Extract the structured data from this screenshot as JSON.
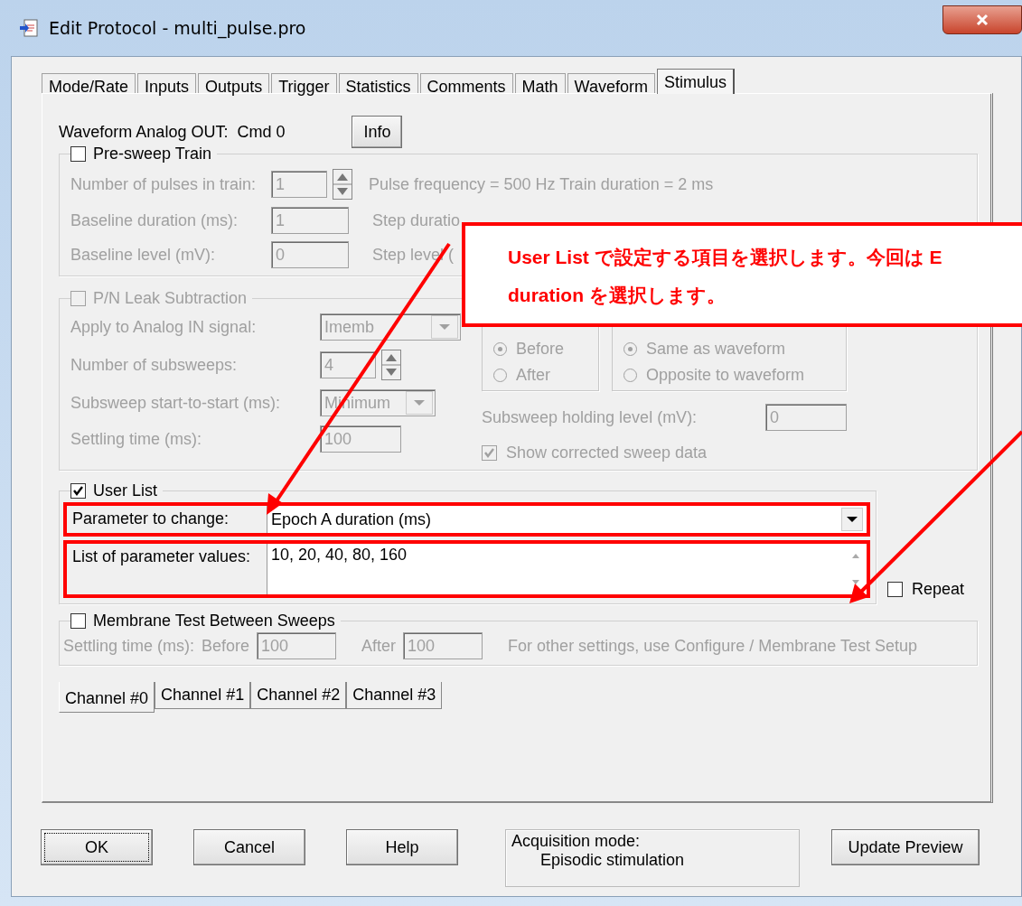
{
  "window": {
    "title": "Edit Protocol - multi_pulse.pro"
  },
  "tabs": [
    {
      "label": "Mode/Rate",
      "selected": false
    },
    {
      "label": "Inputs",
      "selected": false
    },
    {
      "label": "Outputs",
      "selected": false
    },
    {
      "label": "Trigger",
      "selected": false
    },
    {
      "label": "Statistics",
      "selected": false
    },
    {
      "label": "Comments",
      "selected": false
    },
    {
      "label": "Math",
      "selected": false
    },
    {
      "label": "Waveform",
      "selected": false
    },
    {
      "label": "Stimulus",
      "selected": true
    }
  ],
  "waveform_output": {
    "label": "Waveform Analog OUT:",
    "value": "Cmd 0",
    "button": "Info"
  },
  "presweep_train": {
    "label": "Pre-sweep Train",
    "checked": false,
    "pulses_label": "Number of pulses in train:",
    "pulses_value": "1",
    "summary": "Pulse frequency = 500 Hz  Train duration = 2 ms",
    "baseline_duration_label": "Baseline duration (ms):",
    "baseline_duration_value": "1",
    "step_duration_label": "Step duratio",
    "baseline_level_label": "Baseline level (mV):",
    "baseline_level_value": "0",
    "step_level_label": "Step level ("
  },
  "pn_leak": {
    "label": "P/N Leak Subtraction",
    "checked": false,
    "disabled": true,
    "apply_label": "Apply to Analog IN signal:",
    "apply_value": "Imemb",
    "subsweeps_label": "Number of subsweeps:",
    "subsweeps_value": "4",
    "start_label": "Subsweep start-to-start (ms):",
    "start_value": "Minimum",
    "settling_label": "Settling time (ms):",
    "settling_value": "100",
    "execution": [
      {
        "label": "Before",
        "selected": true
      },
      {
        "label": "After",
        "selected": false
      }
    ],
    "polarity": [
      {
        "label": "Same as waveform",
        "selected": true
      },
      {
        "label": "Opposite to waveform",
        "selected": false
      }
    ],
    "holding_label": "Subsweep holding level (mV):",
    "holding_value": "0",
    "show_corrected": {
      "label": "Show corrected sweep data",
      "checked": true
    }
  },
  "user_list": {
    "label": "User List",
    "checked": true,
    "parameter_label": "Parameter to change:",
    "parameter_value": "Epoch A duration (ms)",
    "values_label": "List of parameter values:",
    "values_value": "10, 20, 40, 80, 160",
    "repeat": {
      "label": "Repeat",
      "checked": false
    }
  },
  "membrane_test": {
    "label": "Membrane Test Between Sweeps",
    "checked": false,
    "settling_label": "Settling time (ms):",
    "before_label": "Before",
    "before_value": "100",
    "after_label": "After",
    "after_value": "100",
    "note": "For other settings, use Configure / Membrane Test Setup"
  },
  "channel_tabs": [
    {
      "label": "Channel #0",
      "selected": true
    },
    {
      "label": "Channel #1",
      "selected": false
    },
    {
      "label": "Channel #2",
      "selected": false
    },
    {
      "label": "Channel #3",
      "selected": false
    }
  ],
  "buttons": [
    {
      "label": "OK",
      "focused": true
    },
    {
      "label": "Cancel",
      "focused": false
    },
    {
      "label": "Help",
      "focused": false
    }
  ],
  "acquisition": {
    "label": "Acquisition mode:",
    "value": "Episodic stimulation"
  },
  "update_button": "Update Preview",
  "callout": {
    "lines": [
      "User List で設定する項目を選択します。今回は E",
      "duration を選択します。"
    ]
  }
}
